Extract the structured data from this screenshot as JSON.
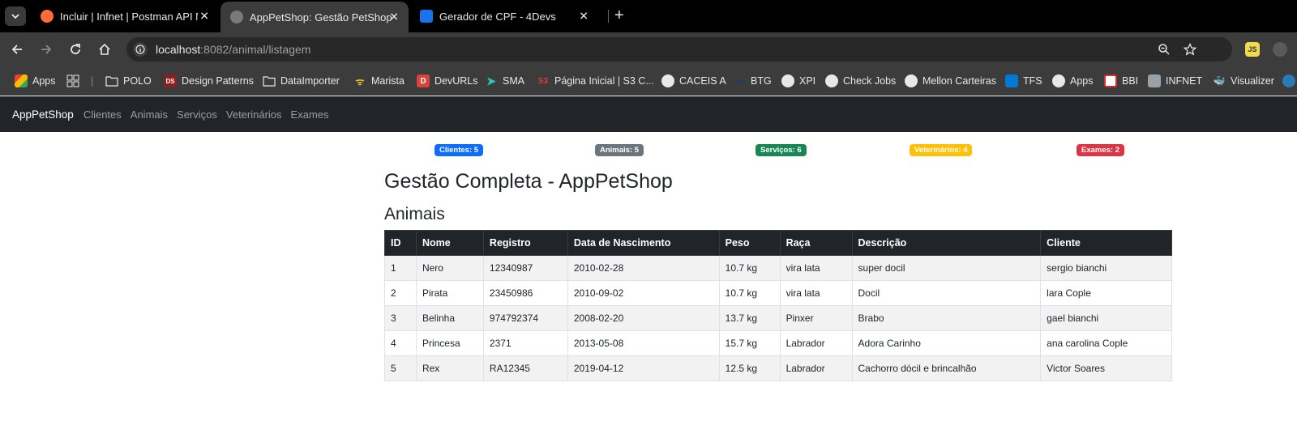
{
  "browser": {
    "tabs": [
      {
        "title": "Incluir | Infnet | Postman API Ne",
        "favicon_color": "#ff6c37"
      },
      {
        "title": "AppPetShop: Gestão PetShop",
        "favicon_color": "#7a7a7a"
      },
      {
        "title": "Gerador de CPF - 4Devs",
        "favicon_color": "#1a73e8"
      }
    ],
    "url_host": "localhost",
    "url_rest": ":8082/animal/listagem",
    "bookmarks": [
      "Apps",
      "POLO",
      "Design Patterns",
      "DataImporter",
      "Marista",
      "DevURLs",
      "SMA",
      "Página Inicial | S3 C...",
      "CACEIS A",
      "BTG",
      "XPI",
      "Check Jobs",
      "Mellon Carteiras",
      "TFS",
      "Apps",
      "BBI",
      "INFNET",
      "Visualizer"
    ],
    "bookmark_icons": {
      "ds": "DS",
      "devurls": "D",
      "s3": "S3",
      "btg": "btg",
      "ext_js": "JS"
    }
  },
  "app": {
    "brand": "AppPetShop",
    "nav": [
      "Clientes",
      "Animais",
      "Serviços",
      "Veterinários",
      "Exames"
    ],
    "badges": [
      {
        "label": "Clientes: 5",
        "bg": "#0d6efd",
        "fg": "#ffffff"
      },
      {
        "label": "Animais: 5",
        "bg": "#6c757d",
        "fg": "#ffffff"
      },
      {
        "label": "Serviços: 6",
        "bg": "#198754",
        "fg": "#ffffff"
      },
      {
        "label": "Veterinários: 4",
        "bg": "#ffc107",
        "fg": "#ffffff"
      },
      {
        "label": "Exames: 2",
        "bg": "#dc3545",
        "fg": "#ffffff"
      }
    ],
    "title": "Gestão Completa - AppPetShop",
    "section": "Animais",
    "table": {
      "headers": [
        "ID",
        "Nome",
        "Registro",
        "Data de Nascimento",
        "Peso",
        "Raça",
        "Descrição",
        "Cliente"
      ],
      "rows": [
        [
          "1",
          "Nero",
          "12340987",
          "2010-02-28",
          "10.7 kg",
          "vira lata",
          "super docil",
          "sergio bianchi"
        ],
        [
          "2",
          "Pirata",
          "23450986",
          "2010-09-02",
          "10.7 kg",
          "vira lata",
          "Docil",
          "lara Cople"
        ],
        [
          "3",
          "Belinha",
          "974792374",
          "2008-02-20",
          "13.7 kg",
          "Pinxer",
          "Brabo",
          "gael bianchi"
        ],
        [
          "4",
          "Princesa",
          "2371",
          "2013-05-08",
          "15.7 kg",
          "Labrador",
          "Adora Carinho",
          "ana carolina Cople"
        ],
        [
          "5",
          "Rex",
          "RA12345",
          "2019-04-12",
          "12.5 kg",
          "Labrador",
          "Cachorro dócil e brincalhão",
          "Victor Soares"
        ]
      ]
    }
  }
}
